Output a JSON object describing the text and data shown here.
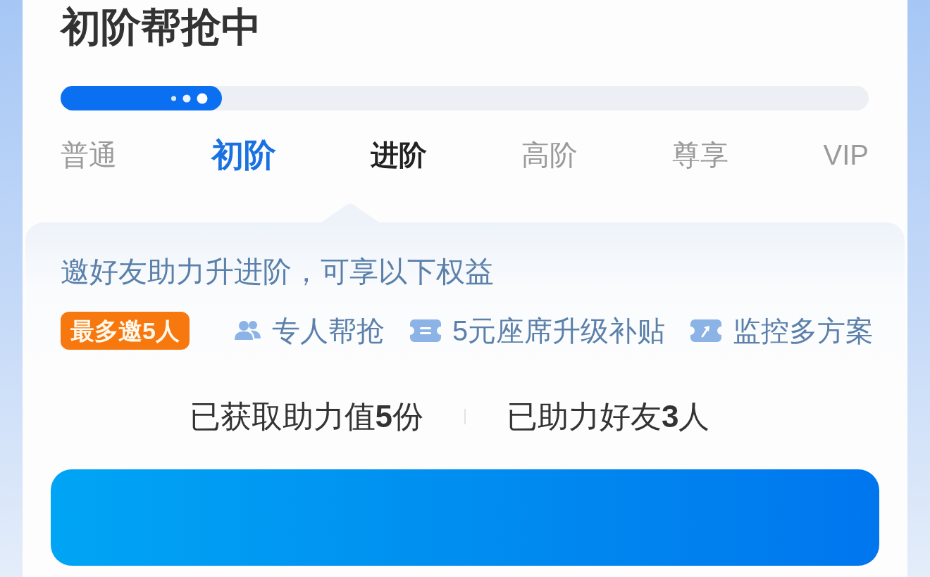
{
  "title": "初阶帮抢中",
  "progress": {
    "level": 0.2
  },
  "tiers": [
    {
      "label": "普通",
      "current": false,
      "selected": false
    },
    {
      "label": "初阶",
      "current": true,
      "selected": false
    },
    {
      "label": "进阶",
      "current": false,
      "selected": true
    },
    {
      "label": "高阶",
      "current": false,
      "selected": false
    },
    {
      "label": "尊享",
      "current": false,
      "selected": false
    },
    {
      "label": "VIP",
      "current": false,
      "selected": false
    }
  ],
  "benefits": {
    "intro": "邀好友助力升进阶，可享以下权益",
    "badge": "最多邀5人",
    "items": [
      {
        "kind": "people",
        "label": "专人帮抢"
      },
      {
        "kind": "ticket",
        "label": "5元座席升级补贴"
      },
      {
        "kind": "ticket_up",
        "label": "监控多方案"
      }
    ]
  },
  "stats": [
    "已获取助力值**5**份",
    "已助力好友**3**人"
  ]
}
